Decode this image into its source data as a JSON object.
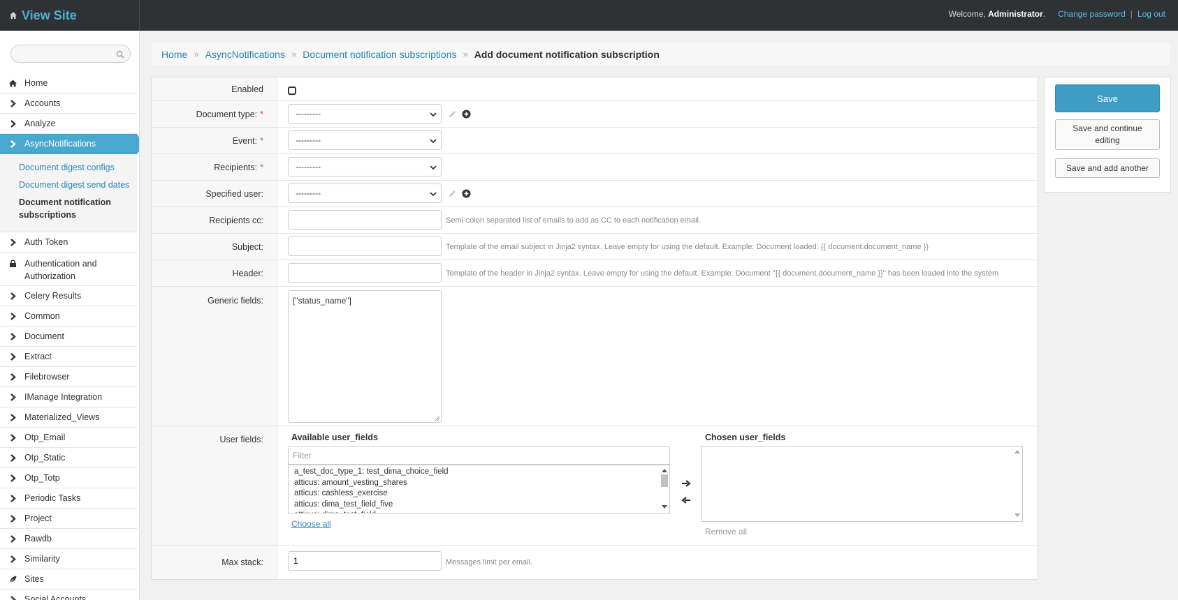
{
  "header": {
    "brand": "View Site",
    "welcome": "Welcome,",
    "username": "Administrator",
    "period": ".",
    "change_password": "Change password",
    "separator": "|",
    "logout": "Log out"
  },
  "sidebar": {
    "search": {
      "value": "",
      "placeholder": ""
    },
    "items": [
      {
        "label": "Home",
        "icon": "home-icon"
      },
      {
        "label": "Accounts",
        "icon": "chevron-right-icon"
      },
      {
        "label": "Analyze",
        "icon": "chevron-right-icon"
      },
      {
        "label": "AsyncNotifications",
        "icon": "chevron-right-icon",
        "active": true
      },
      {
        "label": "Auth Token",
        "icon": "chevron-right-icon"
      },
      {
        "label": "Authentication and Authorization",
        "icon": "lock-icon"
      },
      {
        "label": "Celery Results",
        "icon": "chevron-right-icon"
      },
      {
        "label": "Common",
        "icon": "chevron-right-icon"
      },
      {
        "label": "Document",
        "icon": "chevron-right-icon"
      },
      {
        "label": "Extract",
        "icon": "chevron-right-icon"
      },
      {
        "label": "Filebrowser",
        "icon": "chevron-right-icon"
      },
      {
        "label": "IManage Integration",
        "icon": "chevron-right-icon"
      },
      {
        "label": "Materialized_Views",
        "icon": "chevron-right-icon"
      },
      {
        "label": "Otp_Email",
        "icon": "chevron-right-icon"
      },
      {
        "label": "Otp_Static",
        "icon": "chevron-right-icon"
      },
      {
        "label": "Otp_Totp",
        "icon": "chevron-right-icon"
      },
      {
        "label": "Periodic Tasks",
        "icon": "chevron-right-icon"
      },
      {
        "label": "Project",
        "icon": "chevron-right-icon"
      },
      {
        "label": "Rawdb",
        "icon": "chevron-right-icon"
      },
      {
        "label": "Similarity",
        "icon": "chevron-right-icon"
      },
      {
        "label": "Sites",
        "icon": "leaf-icon"
      },
      {
        "label": "Social Accounts",
        "icon": "chevron-right-icon"
      }
    ],
    "subitems": [
      {
        "label": "Document digest configs"
      },
      {
        "label": "Document digest send dates"
      },
      {
        "label": "Document notification subscriptions",
        "current": true
      }
    ]
  },
  "breadcrumbs": {
    "items": [
      "Home",
      "AsyncNotifications",
      "Document notification subscriptions"
    ],
    "separator": "»",
    "current": "Add document notification subscription"
  },
  "form": {
    "required_mark": "*",
    "enabled": {
      "label": "Enabled",
      "checked": false
    },
    "document_type": {
      "label": "Document type:",
      "value": "---------"
    },
    "event": {
      "label": "Event:",
      "value": "---------"
    },
    "recipients": {
      "label": "Recipients:",
      "value": "---------"
    },
    "specified_user": {
      "label": "Specified user:",
      "value": "---------"
    },
    "recipients_cc": {
      "label": "Recipients cc:",
      "value": "",
      "help": "Semi-colon separated list of emails to add as CC to each notification email."
    },
    "subject": {
      "label": "Subject:",
      "value": "",
      "help": "Template of the email subject in Jinja2 syntax. Leave empty for using the default. Example: Document loaded: {{ document.document_name }}"
    },
    "header": {
      "label": "Header:",
      "value": "",
      "help": "Template of the header in Jinja2 syntax. Leave empty for using the default. Example: Document \"{{ document.document_name }}\" has been loaded into the system"
    },
    "generic_fields": {
      "label": "Generic fields:",
      "value": "[\"status_name\"]"
    },
    "user_fields": {
      "label": "User fields:",
      "available_title": "Available user_fields",
      "filter_placeholder": "Filter",
      "options": [
        "a_test_doc_type_1: test_dima_choice_field",
        "atticus: amount_vesting_shares",
        "atticus: cashless_exercise",
        "atticus: dima_test_field_five",
        "atticus: dima_test_field"
      ],
      "scroll_position": 0.05,
      "choose_all": "Choose all",
      "chosen_title": "Chosen user_fields",
      "remove_all": "Remove all"
    },
    "max_stack": {
      "label": "Max stack:",
      "value": "1",
      "help": "Messages limit per email."
    }
  },
  "submit": {
    "save": "Save",
    "save_continue": "Save and continue editing",
    "save_add": "Save and add another"
  },
  "colors": {
    "header_bg": "#2e3235",
    "accent": "#4aa8d0",
    "link": "#2a85b5",
    "save_button": "#3d9dc4"
  }
}
